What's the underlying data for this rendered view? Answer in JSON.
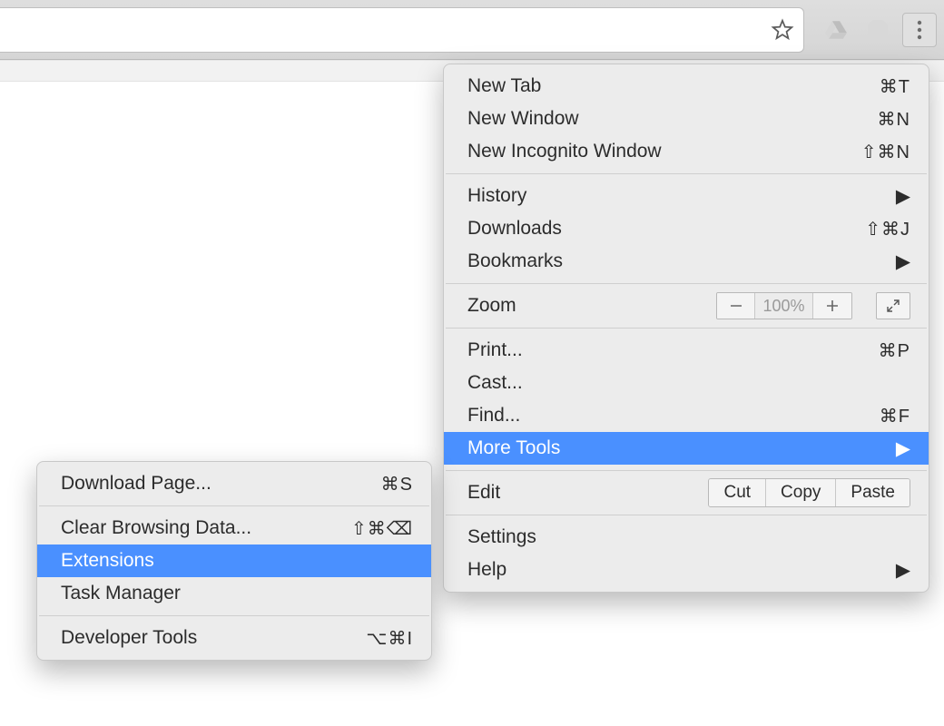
{
  "toolbar": {},
  "main_menu": {
    "new_tab": {
      "label": "New Tab",
      "shortcut": "⌘T"
    },
    "new_window": {
      "label": "New Window",
      "shortcut": "⌘N"
    },
    "new_incognito": {
      "label": "New Incognito Window",
      "shortcut": "⇧⌘N"
    },
    "history": {
      "label": "History"
    },
    "downloads": {
      "label": "Downloads",
      "shortcut": "⇧⌘J"
    },
    "bookmarks": {
      "label": "Bookmarks"
    },
    "zoom": {
      "label": "Zoom",
      "value": "100%"
    },
    "print": {
      "label": "Print...",
      "shortcut": "⌘P"
    },
    "cast": {
      "label": "Cast..."
    },
    "find": {
      "label": "Find...",
      "shortcut": "⌘F"
    },
    "more_tools": {
      "label": "More Tools"
    },
    "edit": {
      "label": "Edit",
      "cut": "Cut",
      "copy": "Copy",
      "paste": "Paste"
    },
    "settings": {
      "label": "Settings"
    },
    "help": {
      "label": "Help"
    }
  },
  "sub_menu": {
    "download_page": {
      "label": "Download Page...",
      "shortcut": "⌘S"
    },
    "clear_browsing": {
      "label": "Clear Browsing Data...",
      "shortcut": "⇧⌘⌫"
    },
    "extensions": {
      "label": "Extensions"
    },
    "task_manager": {
      "label": "Task Manager"
    },
    "developer_tools": {
      "label": "Developer Tools",
      "shortcut": "⌥⌘I"
    }
  }
}
